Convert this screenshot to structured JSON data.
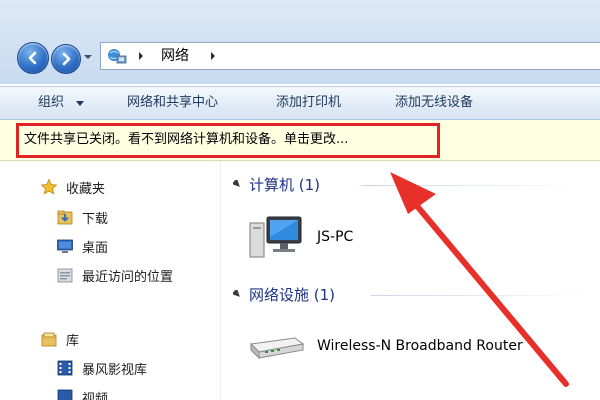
{
  "address_bar": {
    "crumb": "网络"
  },
  "toolbar": {
    "organize": "组织",
    "network_center": "网络和共享中心",
    "add_printer": "添加打印机",
    "add_wireless": "添加无线设备"
  },
  "infobar": {
    "text": "文件共享已关闭。看不到网络计算机和设备。单击更改..."
  },
  "nav": {
    "favorites": "收藏夹",
    "downloads": "下载",
    "desktop": "桌面",
    "recent": "最近访问的位置",
    "libraries": "库",
    "video": "暴风影视库",
    "partial": "视频"
  },
  "content": {
    "computers_header": "计算机 (1)",
    "computer_name": "JS-PC",
    "netdevices_header": "网络设施 (1)",
    "router_name": "Wireless-N Broadband Router"
  },
  "colors": {
    "highlight_red": "#e02424",
    "group_header_blue": "#1e3287",
    "infobar_bg": "#ffffe1"
  },
  "icons": {
    "back": "back-arrow-icon",
    "forward": "forward-arrow-icon",
    "location": "network-location-icon",
    "favorites": "star-icon",
    "downloads": "download-folder-icon",
    "desktop": "desktop-icon",
    "recent": "recent-places-icon",
    "libraries": "libraries-icon",
    "video": "video-library-icon",
    "computer": "computer-icon",
    "router": "router-icon"
  }
}
